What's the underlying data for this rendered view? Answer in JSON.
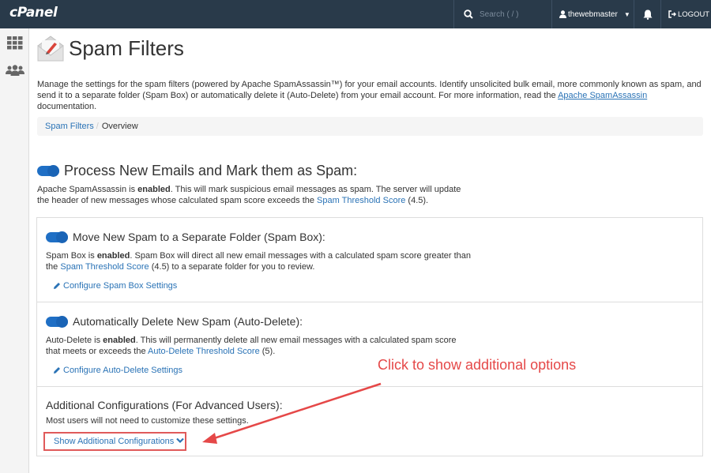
{
  "header": {
    "logo_text": "cPanel",
    "search_placeholder": "Search ( / )",
    "username": "thewebmaster",
    "logout_label": "LOGOUT",
    "colors": {
      "bar": "#293a4a",
      "accent": "#1f6fc5"
    }
  },
  "sidebar": {
    "items": [
      {
        "icon": "apps-grid-icon"
      },
      {
        "icon": "users-icon"
      }
    ]
  },
  "page": {
    "title": "Spam Filters",
    "description_part1": "Manage the settings for the spam filters (powered by Apache SpamAssassin™) for your email accounts. Identify unsolicited bulk email, more commonly known as spam, and send it to a separate folder (Spam Box) or automatically delete it (Auto-Delete) from your email account. For more information, read the ",
    "description_link": "Apache SpamAssassin",
    "description_part2": " documentation."
  },
  "breadcrumb": {
    "parent": "Spam Filters",
    "separator": "/",
    "current": "Overview"
  },
  "process_section": {
    "title": "Process New Emails and Mark them as Spam:",
    "text_a": "Apache SpamAssassin is ",
    "text_bold": "enabled",
    "text_b": ". This will mark suspicious email messages as spam. The server will update the header of new messages whose calculated spam score exceeds the ",
    "link": "Spam Threshold Score",
    "text_c": " (4.5)."
  },
  "spam_box": {
    "title": "Move New Spam to a Separate Folder (Spam Box):",
    "text_a": "Spam Box is ",
    "text_bold": "enabled",
    "text_b": ". Spam Box will direct all new email messages with a calculated spam score greater than the ",
    "link": "Spam Threshold Score",
    "text_c": " (4.5) to a separate folder for you to review.",
    "configure_label": "Configure Spam Box Settings"
  },
  "auto_delete": {
    "title": "Automatically Delete New Spam (Auto-Delete):",
    "text_a": "Auto-Delete is ",
    "text_bold": "enabled",
    "text_b": ". This will permanently delete all new email messages with a calculated spam score that meets or exceeds the ",
    "link": "Auto-Delete Threshold Score",
    "text_c": " (5).",
    "configure_label": "Configure Auto-Delete Settings"
  },
  "additional": {
    "title": "Additional Configurations (For Advanced Users):",
    "note": "Most users will not need to customize these settings.",
    "show_label": "Show Additional Configurations"
  },
  "annotation": {
    "text": "Click to show additional options",
    "color": "#e54848"
  }
}
